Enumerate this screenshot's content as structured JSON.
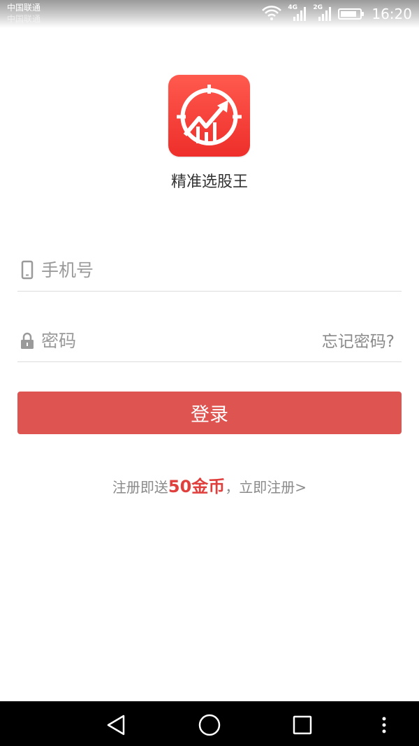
{
  "status_bar": {
    "carrier_1": "中国联通",
    "carrier_2": "中国联通",
    "signal_1_tag": "4G",
    "signal_2_tag": "2G",
    "time": "16:20",
    "battery_level": 0.75
  },
  "app": {
    "name": "精准选股王",
    "brand_color": "#ee2e2a",
    "logo_icon": "target-chart-icon"
  },
  "form": {
    "phone_placeholder": "手机号",
    "password_placeholder": "密码",
    "forgot_label": "忘记密码?",
    "login_label": "登录",
    "phone_icon": "phone-icon",
    "password_icon": "lock-icon"
  },
  "register": {
    "prefix": "注册即送",
    "reward": "50金币",
    "suffix": "，立即注册>"
  },
  "colors": {
    "accent": "#de5450",
    "reward": "#e0403d",
    "hint": "#9a9a9a"
  },
  "nav": {
    "back_icon": "back-triangle-icon",
    "home_icon": "home-circle-icon",
    "recents_icon": "recents-square-icon",
    "menu_icon": "more-dots-icon"
  }
}
